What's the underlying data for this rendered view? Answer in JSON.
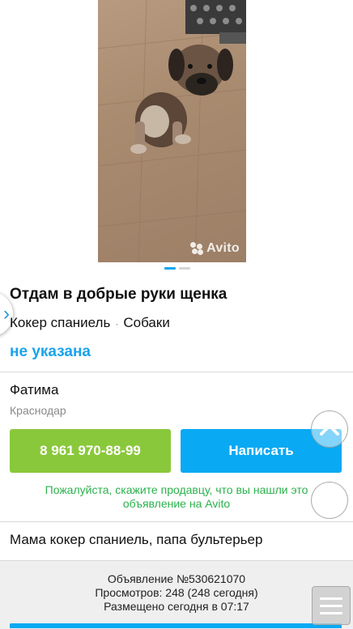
{
  "gallery": {
    "watermark": "Avito",
    "pages_total": 2,
    "page_active": 1
  },
  "listing": {
    "title": "Отдам в добрые руки щенка",
    "category": [
      "Кокер спаниель",
      "Собаки"
    ],
    "category_separator": "·",
    "price": "не указана"
  },
  "seller": {
    "name": "Фатима",
    "city": "Краснодар"
  },
  "actions": {
    "call_label": "8 961 970-88-99",
    "write_label": "Написать"
  },
  "notice": "Пожалуйста, скажите продавцу, что вы нашли это объявление на Avito",
  "description": "Мама кокер спаниель, папа бультерьер",
  "meta": {
    "ad_number": "Объявление №530621070",
    "views": "Просмотров: 248 (248 сегодня)",
    "posted": "Размещено сегодня в 07:17"
  },
  "colors": {
    "accent_blue": "#0aa9f3",
    "call_green": "#8ac83b",
    "notice_green": "#2bb24c"
  },
  "icons": {
    "scroll_up": "chevron-up-icon",
    "scroll_down": "chevron-down-icon",
    "menu": "hamburger-menu-icon",
    "side_nav": "chevron-right-icon"
  }
}
